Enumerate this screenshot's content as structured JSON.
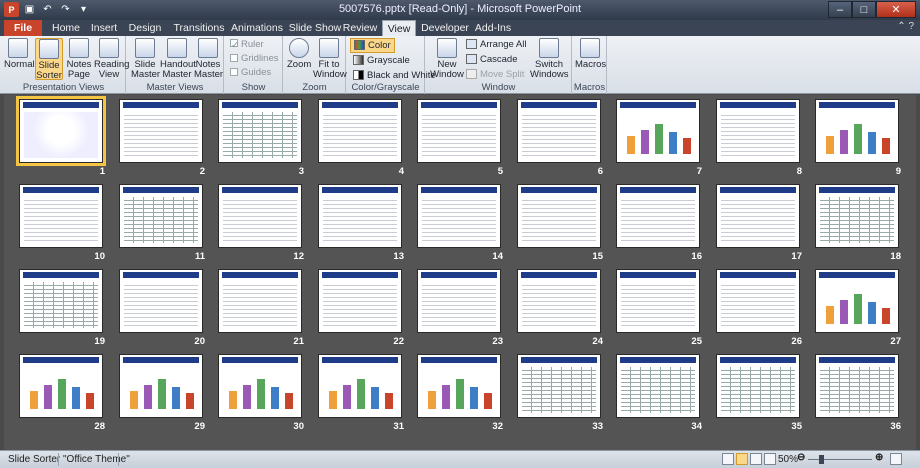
{
  "window": {
    "title": "5007576.pptx [Read-Only] - Microsoft PowerPoint",
    "app_icon": "powerpoint-icon",
    "controls": [
      "minimize-icon",
      "maximize-icon",
      "close-icon"
    ]
  },
  "tabs": [
    {
      "label": "File"
    },
    {
      "label": "Home"
    },
    {
      "label": "Insert"
    },
    {
      "label": "Design"
    },
    {
      "label": "Transitions"
    },
    {
      "label": "Animations"
    },
    {
      "label": "Slide Show"
    },
    {
      "label": "Review"
    },
    {
      "label": "View"
    },
    {
      "label": "Developer"
    },
    {
      "label": "Add-Ins"
    }
  ],
  "active_tab": "View",
  "ribbon": {
    "presentation_views": {
      "label": "Presentation Views",
      "buttons": [
        {
          "label1": "Normal",
          "label2": ""
        },
        {
          "label1": "Slide",
          "label2": "Sorter"
        },
        {
          "label1": "Notes",
          "label2": "Page"
        },
        {
          "label1": "Reading",
          "label2": "View"
        }
      ]
    },
    "master_views": {
      "label": "Master Views",
      "buttons": [
        {
          "label1": "Slide",
          "label2": "Master"
        },
        {
          "label1": "Handout",
          "label2": "Master"
        },
        {
          "label1": "Notes",
          "label2": "Master"
        }
      ]
    },
    "show": {
      "label": "Show",
      "ruler": "Ruler",
      "gridlines": "Gridlines",
      "guides": "Guides"
    },
    "zoom": {
      "label": "Zoom",
      "zoom_btn": "Zoom",
      "fit1": "Fit to",
      "fit2": "Window"
    },
    "color": {
      "label": "Color/Grayscale",
      "color": "Color",
      "grayscale": "Grayscale",
      "bw": "Black and White"
    },
    "window": {
      "label": "Window",
      "new1": "New",
      "new2": "Window",
      "arrange": "Arrange All",
      "cascade": "Cascade",
      "move_split": "Move Split",
      "switch1": "Switch",
      "switch2": "Windows"
    },
    "macros": {
      "label": "Macros",
      "btn": "Macros"
    }
  },
  "slides": [
    {
      "n": "1",
      "kind": "title",
      "selected": true
    },
    {
      "n": "2",
      "kind": "lines"
    },
    {
      "n": "3",
      "kind": "table"
    },
    {
      "n": "4",
      "kind": "lines"
    },
    {
      "n": "5",
      "kind": "mixed"
    },
    {
      "n": "6",
      "kind": "lines"
    },
    {
      "n": "7",
      "kind": "bars"
    },
    {
      "n": "8",
      "kind": "lines"
    },
    {
      "n": "9",
      "kind": "bars"
    },
    {
      "n": "10",
      "kind": "mixed"
    },
    {
      "n": "11",
      "kind": "table"
    },
    {
      "n": "12",
      "kind": "green"
    },
    {
      "n": "13",
      "kind": "green"
    },
    {
      "n": "14",
      "kind": "green"
    },
    {
      "n": "15",
      "kind": "green"
    },
    {
      "n": "16",
      "kind": "green"
    },
    {
      "n": "17",
      "kind": "lines"
    },
    {
      "n": "18",
      "kind": "table"
    },
    {
      "n": "19",
      "kind": "table"
    },
    {
      "n": "20",
      "kind": "org"
    },
    {
      "n": "21",
      "kind": "lines"
    },
    {
      "n": "22",
      "kind": "lines"
    },
    {
      "n": "23",
      "kind": "lines"
    },
    {
      "n": "24",
      "kind": "lines"
    },
    {
      "n": "25",
      "kind": "lines"
    },
    {
      "n": "26",
      "kind": "lines"
    },
    {
      "n": "27",
      "kind": "bars"
    },
    {
      "n": "28",
      "kind": "bars"
    },
    {
      "n": "29",
      "kind": "bars"
    },
    {
      "n": "30",
      "kind": "bars"
    },
    {
      "n": "31",
      "kind": "bars"
    },
    {
      "n": "32",
      "kind": "bars"
    },
    {
      "n": "33",
      "kind": "table"
    },
    {
      "n": "34",
      "kind": "table"
    },
    {
      "n": "35",
      "kind": "table"
    },
    {
      "n": "36",
      "kind": "table"
    }
  ],
  "statusbar": {
    "view": "Slide Sorter",
    "theme": "\"Office Theme\"",
    "zoom": "50%"
  },
  "colors": {
    "accent": "#c8442a",
    "selection": "#f4c542",
    "slide_header": "#1f3c88"
  }
}
